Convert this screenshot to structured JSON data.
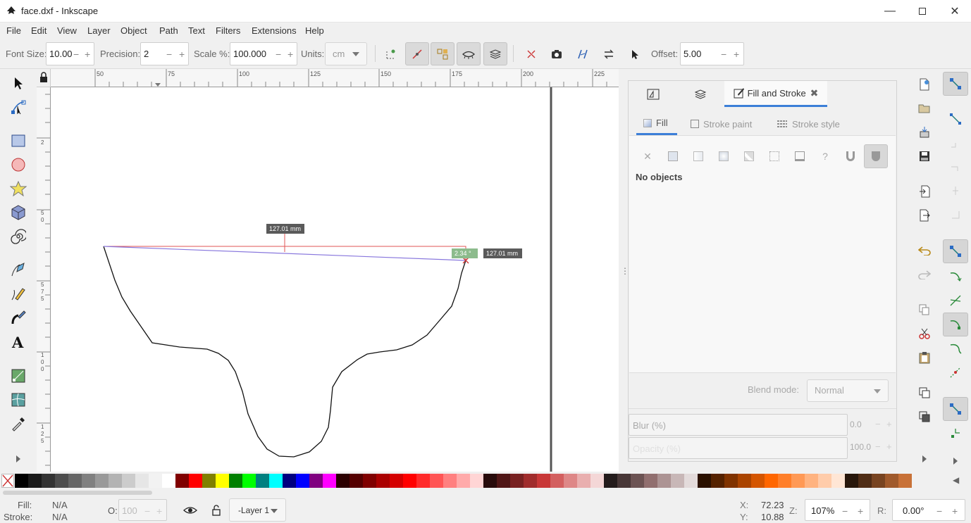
{
  "window": {
    "title": "face.dxf - Inkscape"
  },
  "menu": [
    "File",
    "Edit",
    "View",
    "Layer",
    "Object",
    "Path",
    "Text",
    "Filters",
    "Extensions",
    "Help"
  ],
  "controls": {
    "font_size_label": "Font Size:",
    "font_size": "10.00",
    "precision_label": "Precision:",
    "precision": "2",
    "scale_label": "Scale %:",
    "scale": "100.000",
    "units_label": "Units:",
    "units": "cm",
    "offset_label": "Offset:",
    "offset": "5.00"
  },
  "rulers": {
    "h_ticks": [
      "50",
      "75",
      "100",
      "125",
      "150",
      "175",
      "200",
      "225"
    ],
    "v_marks": [
      "2",
      "5",
      "0",
      "5",
      "7",
      "5",
      "1",
      "0",
      "0",
      "1",
      "2",
      "5"
    ]
  },
  "measurement": {
    "length_top": "127.01 mm",
    "angle": "2.34 °",
    "length_right": "127.01 mm"
  },
  "panel": {
    "tab_label": "Fill and Stroke",
    "subtabs": [
      "Fill",
      "Stroke paint",
      "Stroke style"
    ],
    "message": "No objects",
    "blend_label": "Blend mode:",
    "blend_value": "Normal",
    "blur_label": "Blur (%)",
    "blur_value": "0.0",
    "opacity_label": "Opacity (%)",
    "opacity_value": "100.0"
  },
  "palette": [
    "#000000",
    "#1a1a1a",
    "#333333",
    "#4d4d4d",
    "#666666",
    "#808080",
    "#999999",
    "#b3b3b3",
    "#cccccc",
    "#e6e6e6",
    "#f2f2f2",
    "#ffffff",
    "#800000",
    "#ff0000",
    "#808000",
    "#ffff00",
    "#008000",
    "#00ff00",
    "#008080",
    "#00ffff",
    "#000080",
    "#0000ff",
    "#800080",
    "#ff00ff",
    "#2b0000",
    "#550000",
    "#800000",
    "#aa0000",
    "#d40000",
    "#ff0000",
    "#ff2a2a",
    "#ff5555",
    "#ff8080",
    "#ffaaaa",
    "#ffd5d5",
    "#280b0b",
    "#501616",
    "#782121",
    "#a02c2c",
    "#c83737",
    "#d35f5f",
    "#de8787",
    "#e9afaf",
    "#f4d7d7",
    "#241c1c",
    "#483737",
    "#6c5353",
    "#916f6f",
    "#ac9393",
    "#c8b7b7",
    "#e3dbdb",
    "#2b1100",
    "#552200",
    "#803300",
    "#aa4400",
    "#d45500",
    "#ff6600",
    "#ff7f2a",
    "#ff9955",
    "#ffb380",
    "#ffccaa",
    "#ffe6d5",
    "#28170b",
    "#502d16",
    "#784421",
    "#a05a2c",
    "#c87137"
  ],
  "status": {
    "fill_label": "Fill:",
    "fill_value": "N/A",
    "stroke_label": "Stroke:",
    "stroke_value": "N/A",
    "opacity_label": "O:",
    "opacity_value": "100",
    "layer": "-Layer 1",
    "x_label": "X:",
    "x_value": "72.23",
    "y_label": "Y:",
    "y_value": "10.88",
    "zoom_label": "Z:",
    "zoom_value": "107%",
    "rotation_label": "R:",
    "rotation_value": "0.00°"
  }
}
